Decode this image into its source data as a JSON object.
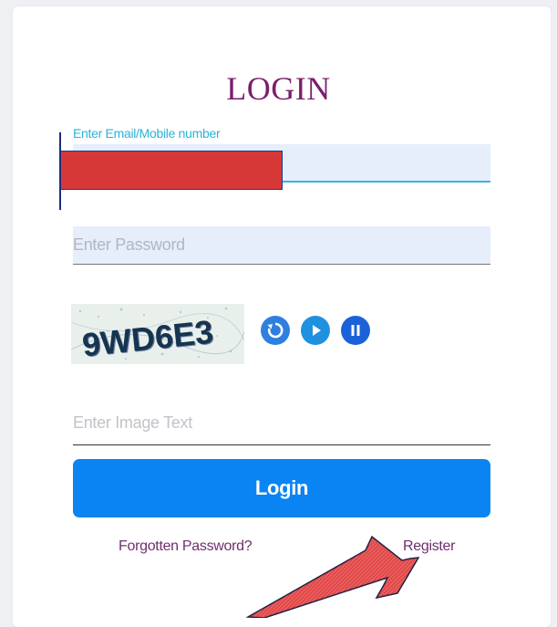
{
  "login": {
    "title": "LOGIN",
    "email_label": "Enter Email/Mobile number",
    "email_value": "",
    "password_placeholder": "Enter Password",
    "captcha_text": "9WD6E3",
    "captcha_input_placeholder": "Enter Image Text",
    "login_button": "Login",
    "forgot_password": "Forgotten Password?",
    "register": "Register"
  },
  "icons": {
    "refresh": "refresh-icon",
    "play": "play-audio-icon",
    "pause": "pause-icon"
  },
  "colors": {
    "title": "#7a1f6b",
    "label_accent": "#28b4d8",
    "primary_button": "#0b84f3",
    "link": "#6f2f6e",
    "redaction": "#d63838",
    "annotation_arrow": "#e04040"
  }
}
